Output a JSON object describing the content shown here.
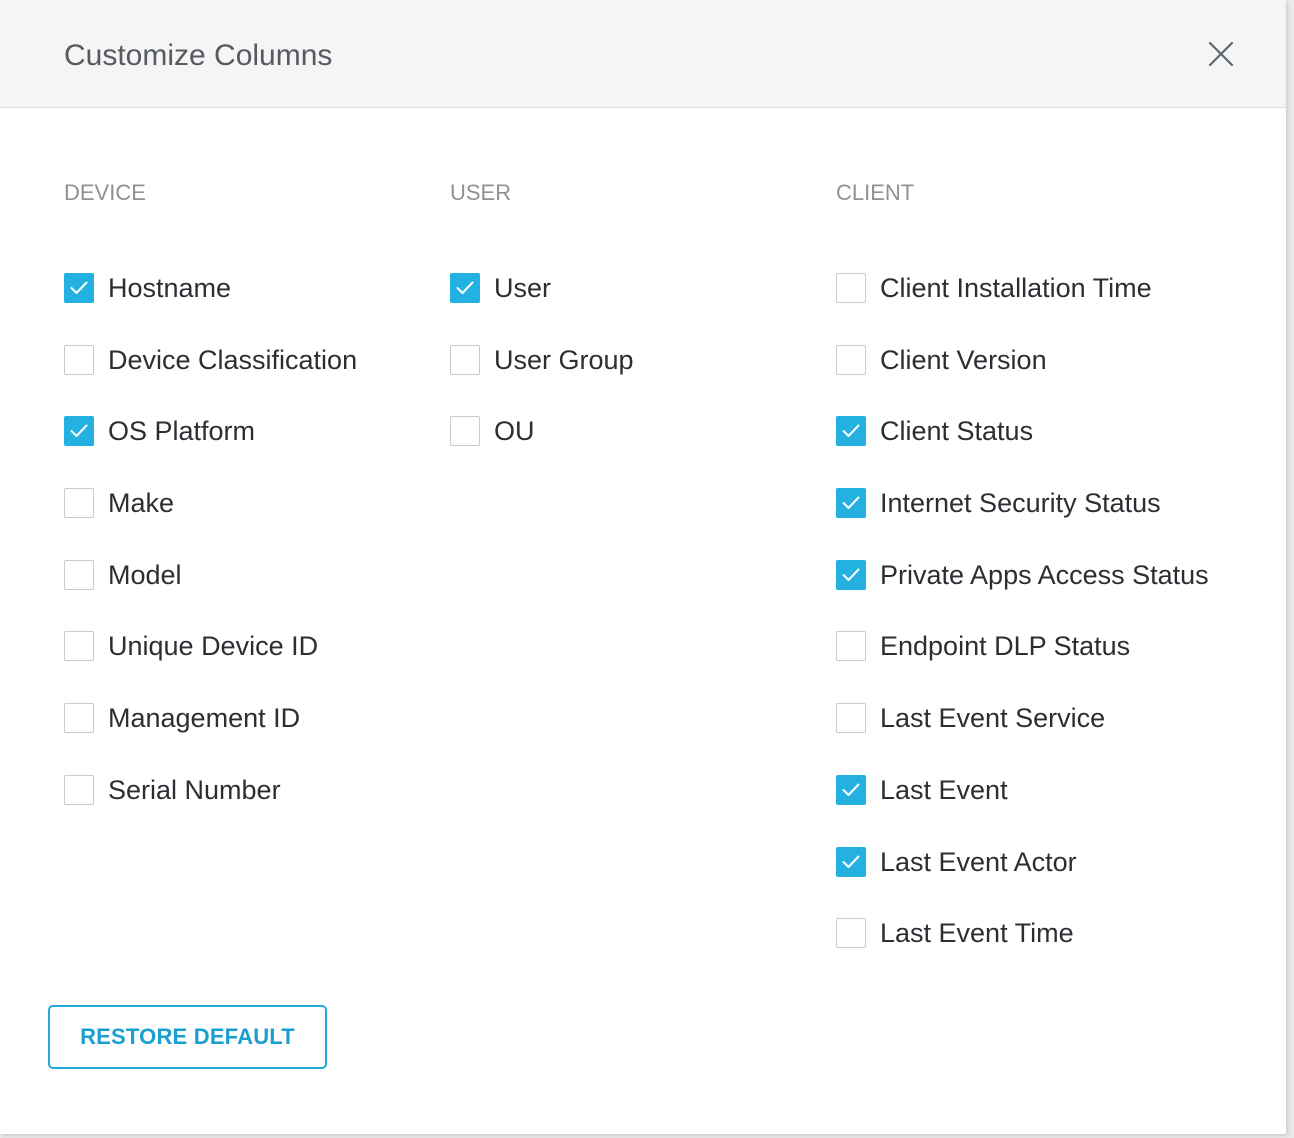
{
  "dialog": {
    "title": "Customize Columns",
    "close_icon": "close-icon"
  },
  "columns": {
    "device": {
      "heading": "DEVICE",
      "options": [
        {
          "label": "Hostname",
          "checked": true
        },
        {
          "label": "Device Classification",
          "checked": false
        },
        {
          "label": "OS Platform",
          "checked": true
        },
        {
          "label": "Make",
          "checked": false
        },
        {
          "label": "Model",
          "checked": false
        },
        {
          "label": "Unique Device ID",
          "checked": false
        },
        {
          "label": "Management ID",
          "checked": false
        },
        {
          "label": "Serial Number",
          "checked": false
        }
      ]
    },
    "user": {
      "heading": "USER",
      "options": [
        {
          "label": "User",
          "checked": true
        },
        {
          "label": "User Group",
          "checked": false
        },
        {
          "label": "OU",
          "checked": false
        }
      ]
    },
    "client": {
      "heading": "CLIENT",
      "options": [
        {
          "label": "Client Installation Time",
          "checked": false
        },
        {
          "label": "Client Version",
          "checked": false
        },
        {
          "label": "Client Status",
          "checked": true
        },
        {
          "label": "Internet Security Status",
          "checked": true
        },
        {
          "label": "Private Apps Access Status",
          "checked": true
        },
        {
          "label": "Endpoint DLP Status",
          "checked": false
        },
        {
          "label": "Last Event Service",
          "checked": false
        },
        {
          "label": "Last Event",
          "checked": true
        },
        {
          "label": "Last Event Actor",
          "checked": true
        },
        {
          "label": "Last Event Time",
          "checked": false
        }
      ]
    }
  },
  "footer": {
    "restore_label": "RESTORE DEFAULT"
  },
  "colors": {
    "accent": "#23b1e1",
    "button_text": "#1a9fd3",
    "heading_text": "#8e9196",
    "title_text": "#555b61"
  }
}
